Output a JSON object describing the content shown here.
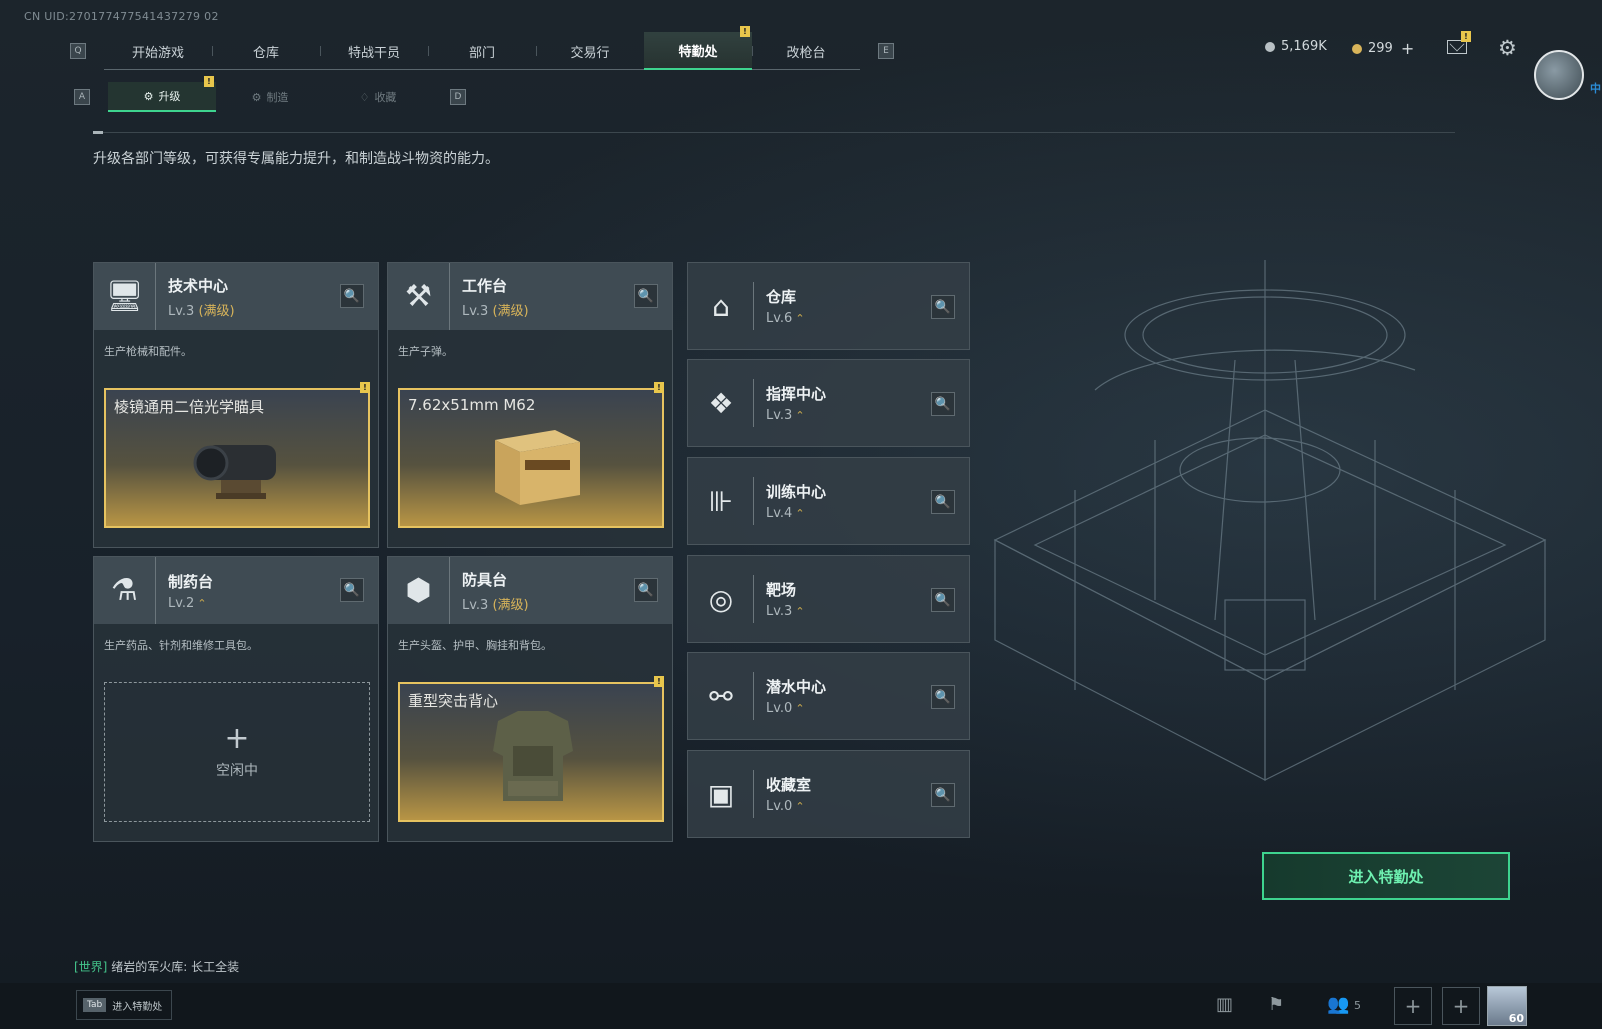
{
  "uid": "CN UID:270177477541437279 02",
  "topnav": {
    "key_left": "Q",
    "key_right": "E",
    "tabs": [
      {
        "label": "开始游戏",
        "active": false
      },
      {
        "label": "仓库",
        "active": false
      },
      {
        "label": "特战干员",
        "active": false
      },
      {
        "label": "部门",
        "active": false
      },
      {
        "label": "交易行",
        "active": false
      },
      {
        "label": "特勤处",
        "active": true,
        "badge": "!"
      },
      {
        "label": "改枪台",
        "active": false
      }
    ]
  },
  "resources": {
    "silver": "5,169K",
    "gold": "299",
    "gold_plus": "+"
  },
  "avatar_tag": "中",
  "subnav": {
    "key_left": "A",
    "key_right": "D",
    "tabs": [
      {
        "label": "升级",
        "active": true,
        "badge": "!"
      },
      {
        "label": "制造",
        "active": false
      },
      {
        "label": "收藏",
        "active": false
      }
    ]
  },
  "description": "升级各部门等级，可获得专属能力提升，和制造战斗物资的能力。",
  "big_cards": [
    {
      "name": "技术中心",
      "level": "Lv.3",
      "maxed": "(满级)",
      "desc": "生产枪械和配件。",
      "product": "棱镜通用二倍光学瞄具",
      "badge": "!",
      "icon": "computer-icon"
    },
    {
      "name": "工作台",
      "level": "Lv.3",
      "maxed": "(满级)",
      "desc": "生产子弹。",
      "product": "7.62x51mm M62",
      "badge": "!",
      "icon": "tools-icon"
    },
    {
      "name": "制药台",
      "level": "Lv.2",
      "maxed": "",
      "desc": "生产药品、针剂和维修工具包。",
      "product": "",
      "idle": "空闲中",
      "icon": "microscope-icon"
    },
    {
      "name": "防具台",
      "level": "Lv.3",
      "maxed": "(满级)",
      "desc": "生产头盔、护甲、胸挂和背包。",
      "product": "重型突击背心",
      "badge": "!",
      "icon": "blocks-icon"
    }
  ],
  "small_cards": [
    {
      "name": "仓库",
      "level": "Lv.6",
      "icon": "warehouse-icon"
    },
    {
      "name": "指挥中心",
      "level": "Lv.3",
      "icon": "command-icon"
    },
    {
      "name": "训练中心",
      "level": "Lv.4",
      "icon": "dumbbell-icon"
    },
    {
      "name": "靶场",
      "level": "Lv.3",
      "icon": "target-icon"
    },
    {
      "name": "潜水中心",
      "level": "Lv.0",
      "icon": "diving-mask-icon"
    },
    {
      "name": "收藏室",
      "level": "Lv.0",
      "icon": "collection-icon"
    }
  ],
  "enter_button": "进入特勤处",
  "chat": {
    "channel": "[世界]",
    "sender": "绪岩的军火库:",
    "message": "长工全装"
  },
  "bottom": {
    "tab_key": "Tab",
    "tab_label": "进入特勤处",
    "friends_count": "5",
    "avatar_level": "60"
  },
  "colors": {
    "accent_green": "#3ed48f",
    "gold": "#e6c360",
    "badge_yellow": "#e8c64c"
  }
}
